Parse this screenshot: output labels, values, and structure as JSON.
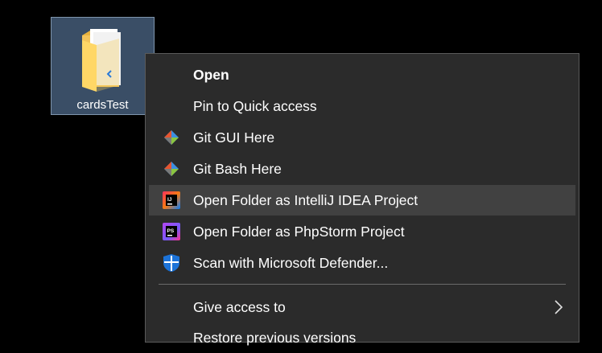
{
  "desktop": {
    "folder_name": "cardsTest"
  },
  "context_menu": {
    "items": [
      {
        "label": "Open",
        "icon": ""
      },
      {
        "label": "Pin to Quick access",
        "icon": ""
      },
      {
        "label": "Git GUI Here",
        "icon": "git-icon"
      },
      {
        "label": "Git Bash Here",
        "icon": "git-icon"
      },
      {
        "label": "Open Folder as IntelliJ IDEA Project",
        "icon": "intellij-icon"
      },
      {
        "label": "Open Folder as PhpStorm Project",
        "icon": "phpstorm-icon"
      },
      {
        "label": "Scan with Microsoft Defender...",
        "icon": "defender-shield-icon"
      },
      {
        "label": "Give access to",
        "icon": ""
      },
      {
        "label": "Restore previous versions",
        "icon": ""
      }
    ],
    "highlighted_item": "Open Folder as IntelliJ IDEA Project"
  },
  "colors": {
    "desktop_bg": "#000000",
    "menu_bg": "#2b2b2b",
    "menu_hover": "#414141",
    "selection_bg": "#3a4e66",
    "defender_blue": "#1c73d8",
    "git_orange": "#e8552f",
    "git_green": "#8bc53f",
    "git_blue": "#3d8ee0"
  }
}
